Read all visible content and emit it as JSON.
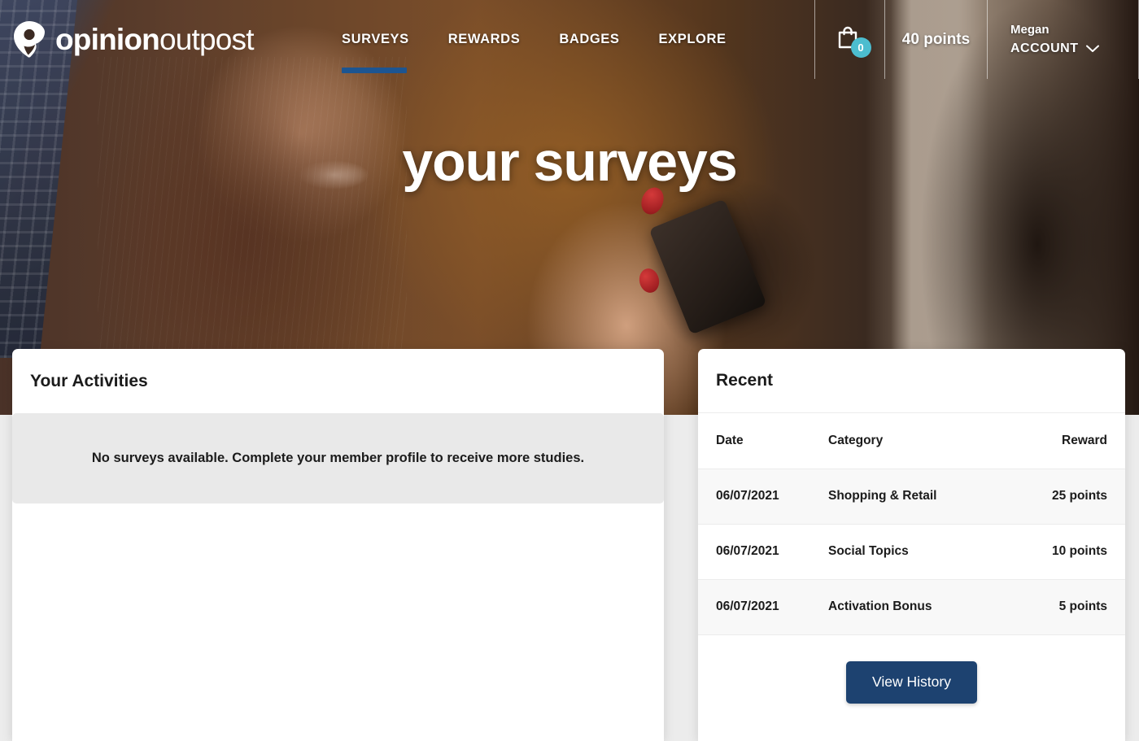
{
  "brand": {
    "logo_bold": "opinion",
    "logo_light": "outpost",
    "logo_icon": "opinion-pin-icon",
    "accent_navy": "#1d4270",
    "accent_blue": "#1d5591",
    "accent_teal": "#4cbdcf"
  },
  "nav": {
    "items": [
      {
        "label": "SURVEYS",
        "active": true
      },
      {
        "label": "REWARDS",
        "active": false
      },
      {
        "label": "BADGES",
        "active": false
      },
      {
        "label": "EXPLORE",
        "active": false
      }
    ]
  },
  "header": {
    "cart_icon": "shopping-bag-icon",
    "cart_count": "0",
    "points": "40 points",
    "account_name": "Megan",
    "account_label": "ACCOUNT",
    "account_chevron": "chevron-down-icon"
  },
  "hero": {
    "title": "your surveys"
  },
  "activities": {
    "title": "Your Activities",
    "empty_message": "No surveys available. Complete your member profile to receive more studies."
  },
  "recent": {
    "title": "Recent",
    "columns": [
      "Date",
      "Category",
      "Reward"
    ],
    "rows": [
      {
        "date": "06/07/2021",
        "category": "Shopping & Retail",
        "reward": "25 points"
      },
      {
        "date": "06/07/2021",
        "category": "Social Topics",
        "reward": "10 points"
      },
      {
        "date": "06/07/2021",
        "category": "Activation Bonus",
        "reward": "5 points"
      }
    ],
    "view_history_label": "View History"
  }
}
